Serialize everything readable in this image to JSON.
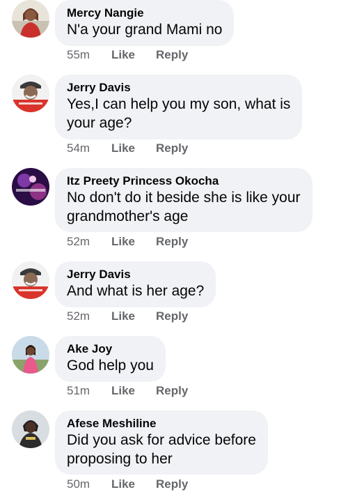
{
  "actions": {
    "like": "Like",
    "reply": "Reply"
  },
  "comments": [
    {
      "author": "Mercy Nangie",
      "lines": [
        "N'a your grand Mami no"
      ],
      "time": "55m",
      "avatar": "woman-photo"
    },
    {
      "author": "Jerry Davis",
      "lines": [
        "Yes,I can help you my son, what is",
        "your age?"
      ],
      "time": "54m",
      "avatar": "man-cap-photo"
    },
    {
      "author": "Itz Preety Princess Okocha",
      "lines": [
        "No don't do it beside she is like your",
        "grandmother's age"
      ],
      "time": "52m",
      "avatar": "purple-graphic"
    },
    {
      "author": "Jerry Davis",
      "lines": [
        "And what is her age?"
      ],
      "time": "52m",
      "avatar": "man-cap-photo"
    },
    {
      "author": "Ake Joy",
      "lines": [
        "God help you"
      ],
      "time": "51m",
      "avatar": "woman-outdoor-photo"
    },
    {
      "author": "Afese Meshiline",
      "lines": [
        "Did you ask for advice before",
        "proposing to her"
      ],
      "time": "50m",
      "avatar": "woman-scarf-photo"
    }
  ],
  "colors": {
    "bubble": "#f0f2f5",
    "meta_text": "#65676b",
    "body_text": "#050505"
  }
}
